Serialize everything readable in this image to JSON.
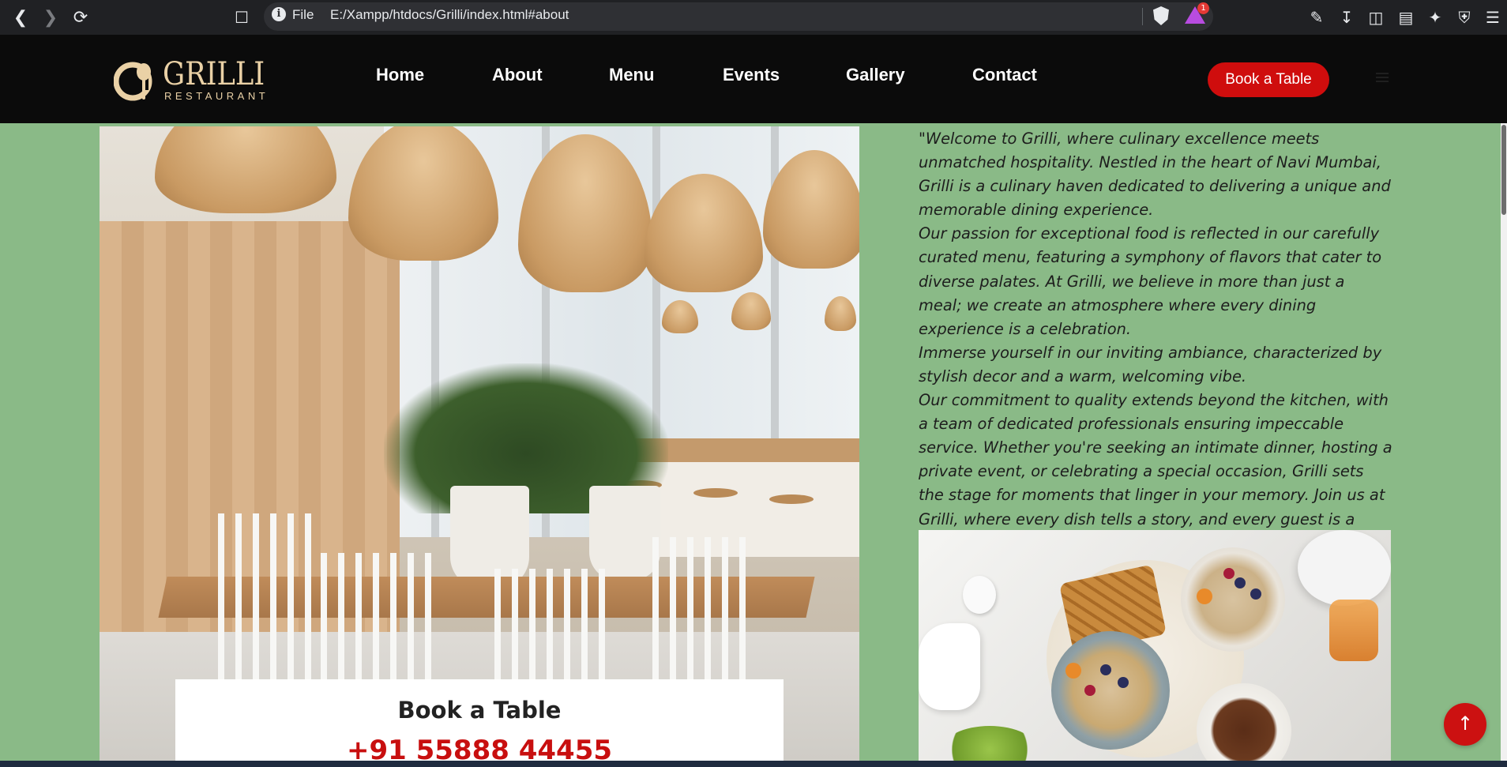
{
  "browser": {
    "back_icon": "back-arrow-icon",
    "forward_icon": "forward-arrow-icon",
    "reload_icon": "reload-icon",
    "bookmark_icon": "bookmark-icon",
    "info_label": "File",
    "url": "E:/Xampp/htdocs/Grilli/index.html#about",
    "rewards_badge": "1",
    "toolbar_icons": [
      "extensions-icon",
      "downloads-icon",
      "sidebar-icon",
      "wallet-icon",
      "leo-ai-icon",
      "vpn-shield-icon",
      "menu-icon"
    ]
  },
  "header": {
    "logo": {
      "title": "GRILLI",
      "subtitle": "RESTAURANT"
    },
    "nav": [
      {
        "label": "Home"
      },
      {
        "label": "About"
      },
      {
        "label": "Menu"
      },
      {
        "label": "Events"
      },
      {
        "label": "Gallery"
      },
      {
        "label": "Contact"
      }
    ],
    "cta": "Book a Table"
  },
  "about": {
    "paragraph": "\"Welcome to Grilli, where culinary excellence meets unmatched hospitality. Nestled in the heart of Navi Mumbai, Grilli is a culinary haven dedicated to delivering a unique and memorable dining experience.\nOur passion for exceptional food is reflected in our carefully curated menu, featuring a symphony of flavors that cater to diverse palates. At Grilli, we believe in more than just a meal; we create an atmosphere where every dining experience is a celebration.\nImmerse yourself in our inviting ambiance, characterized by stylish decor and a warm, welcoming vibe.\nOur commitment to quality extends beyond the kitchen, with a team of dedicated professionals ensuring impeccable service. Whether you're seeking an intimate dinner, hosting a private event, or celebrating a special occasion, Grilli sets the stage for moments that linger in your memory. Join us at Grilli, where every dish tells a story, and every guest is a cherished part of our culinary journey.\"",
    "book_card": {
      "title": "Book a Table",
      "phone": "+91 55888 44455"
    }
  },
  "colors": {
    "page_bg": "#8aba87",
    "header_bg": "#0b0b0b",
    "accent_red": "#cf0d0d",
    "logo_gold": "#ead1a6"
  }
}
